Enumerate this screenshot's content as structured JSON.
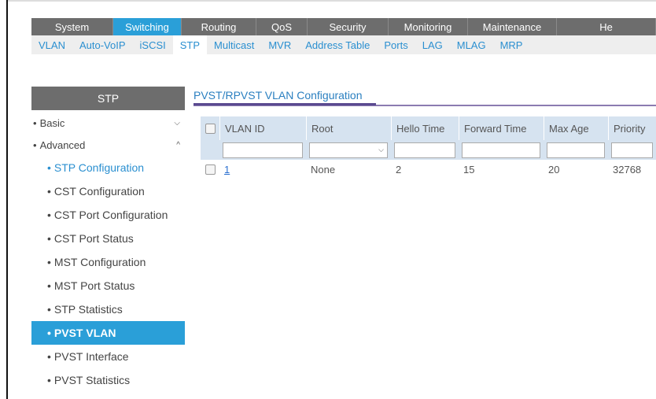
{
  "main_nav": [
    "System",
    "Switching",
    "Routing",
    "QoS",
    "Security",
    "Monitoring",
    "Maintenance",
    "He"
  ],
  "sub_nav": [
    "VLAN",
    "Auto-VoIP",
    "iSCSI",
    "STP",
    "Multicast",
    "MVR",
    "Address Table",
    "Ports",
    "LAG",
    "MLAG",
    "MRP"
  ],
  "sidebar": {
    "title": "STP",
    "groups": [
      "Basic",
      "Advanced"
    ],
    "items": [
      "STP Configuration",
      "CST Configuration",
      "CST Port Configuration",
      "CST Port Status",
      "MST Configuration",
      "MST Port Status",
      "STP Statistics",
      "PVST VLAN",
      "PVST Interface",
      "PVST Statistics"
    ]
  },
  "content": {
    "title": "PVST/RPVST VLAN Configuration",
    "columns": [
      "VLAN ID",
      "Root",
      "Hello Time",
      "Forward Time",
      "Max Age",
      "Priority"
    ],
    "rows": [
      {
        "vlan_id": "1",
        "root": "None",
        "hello_time": "2",
        "forward_time": "15",
        "max_age": "20",
        "priority": "32768"
      }
    ]
  },
  "colors": {
    "accent": "#2a9fd8",
    "nav_bg": "#6d6d6d",
    "header_bg": "#d6e3f0"
  }
}
